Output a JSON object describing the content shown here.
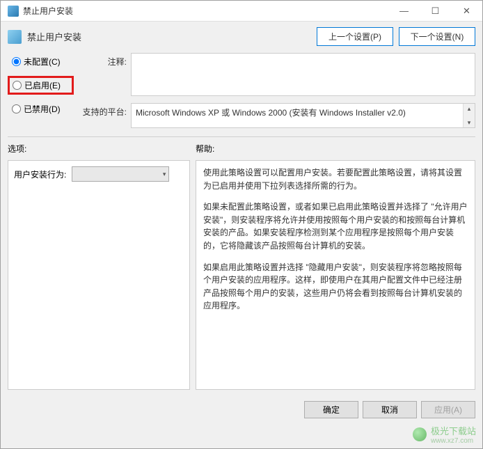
{
  "window": {
    "title": "禁止用户安装",
    "min": "—",
    "max": "☐",
    "close": "✕"
  },
  "header": {
    "title": "禁止用户安装",
    "prev": "上一个设置(P)",
    "next": "下一个设置(N)"
  },
  "radios": {
    "not_configured": "未配置(C)",
    "enabled": "已启用(E)",
    "disabled": "已禁用(D)"
  },
  "labels": {
    "comments": "注释:",
    "platforms": "支持的平台:",
    "options": "选项:",
    "help": "帮助:"
  },
  "comments_value": "",
  "platforms_value": "Microsoft Windows XP 或 Windows 2000 (安装有 Windows Installer v2.0)",
  "option_rows": {
    "user_install_behavior": "用户安装行为:"
  },
  "combo_value": "",
  "help_text": {
    "p1": "使用此策略设置可以配置用户安装。若要配置此策略设置，请将其设置为已启用并使用下拉列表选择所需的行为。",
    "p2": "如果未配置此策略设置，或者如果已启用此策略设置并选择了 \"允许用户安装\"，则安装程序将允许并使用按照每个用户安装的和按照每台计算机安装的产品。如果安装程序检测到某个应用程序是按照每个用户安装的，它将隐藏该产品按照每台计算机的安装。",
    "p3": "如果启用此策略设置并选择 \"隐藏用户安装\"，则安装程序将忽略按照每个用户安装的应用程序。这样，即使用户在其用户配置文件中已经注册产品按照每个用户的安装，这些用户仍将会看到按照每台计算机安装的应用程序。"
  },
  "footer": {
    "ok": "确定",
    "cancel": "取消",
    "apply": "应用(A)"
  },
  "watermark": {
    "name": "极光下载站",
    "url": "www.xz7.com"
  }
}
